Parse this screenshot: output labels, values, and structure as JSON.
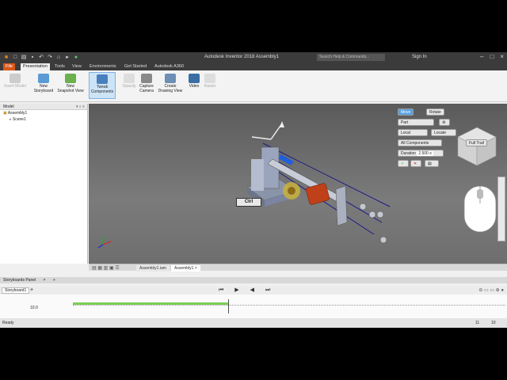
{
  "titlebar": {
    "app_title": "Autodesk Inventor 2018   Assembly1",
    "search_placeholder": "Search Help & Commands...",
    "sign_in": "Sign In"
  },
  "tabs": [
    "File",
    "Presentation",
    "Tools",
    "View",
    "Environments",
    "Get Started",
    "Autodesk A360"
  ],
  "ribbon": {
    "insert_model": "Insert Model",
    "new_storyboard": "New\nStoryboard",
    "new_snapshot": "New\nSnapshot View",
    "tweak": "Tweak\nComponents",
    "opacity": "Opacity",
    "capture_camera": "Capture\nCamera",
    "create_drawing": "Create\nDrawing View",
    "video": "Video",
    "raster": "Raster"
  },
  "browser": {
    "title": "Model",
    "root": "Assembly1",
    "child": "Scene1"
  },
  "tweak_toolbar": {
    "move": "Move",
    "rotate": "Rotate",
    "part": "Part",
    "local": "Local",
    "locate": "Locate",
    "all_components": "All Components",
    "duration_label": "Duration",
    "duration_value": "2.500 s"
  },
  "viewcube": {
    "label": "Full Trail"
  },
  "viewport": {
    "ctrl_label": "Ctrl"
  },
  "doc_tabs": [
    "Assembly1.iam",
    "Assembly1"
  ],
  "storyboard": {
    "panel_title": "Storyboards Panel",
    "tab": "Storyboard1",
    "time_value": "10.0"
  },
  "status": {
    "text": "Ready",
    "count_a": "11",
    "count_b": "10"
  },
  "colors": {
    "file_tab": "#d9581b",
    "title_bg": "#3b3b3b",
    "active_tool": "#cde4f7",
    "move_button": "#5aa0e0",
    "viewport_top": "#5a5a5a"
  }
}
